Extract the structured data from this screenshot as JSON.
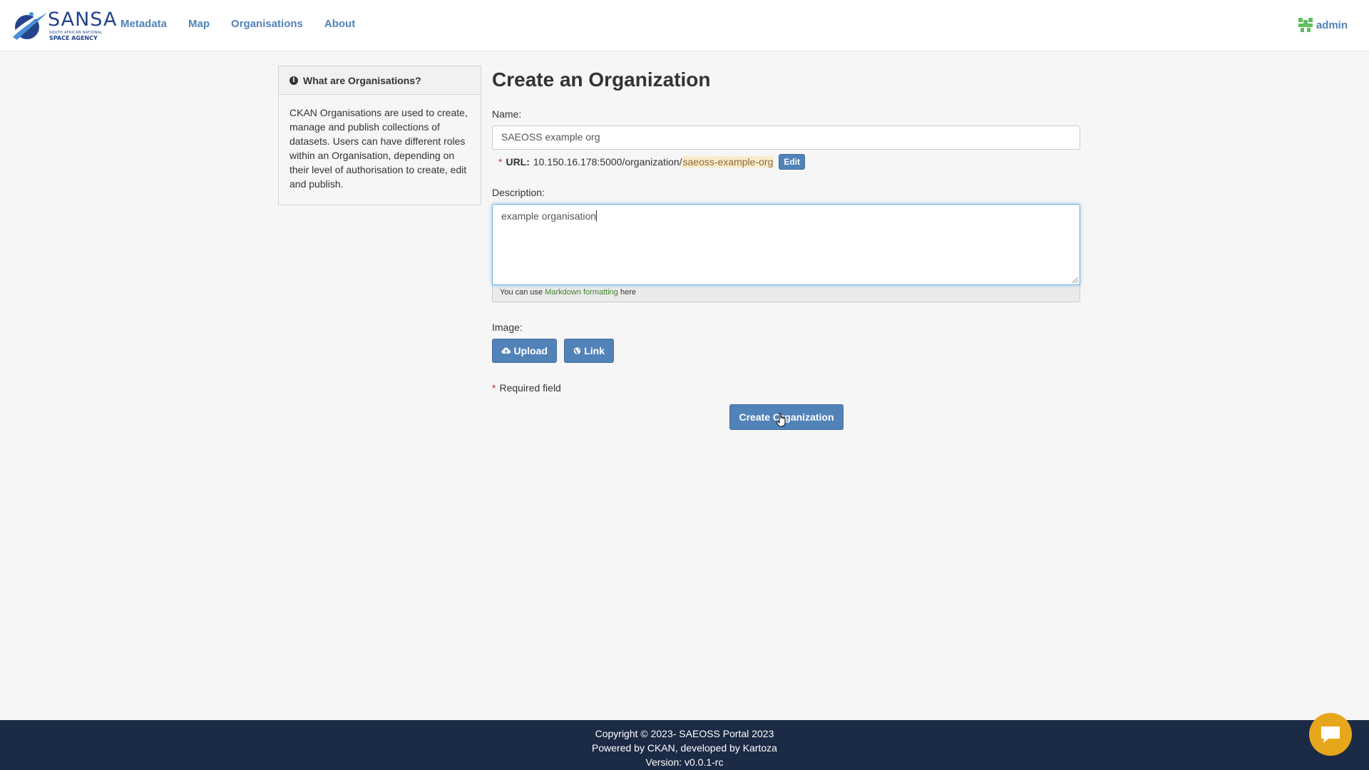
{
  "header": {
    "logo": {
      "main": "SANSA",
      "sub1": "SOUTH AFRICAN NATIONAL",
      "sub2": "SPACE AGENCY"
    },
    "nav": [
      {
        "label": "Metadata"
      },
      {
        "label": "Map"
      },
      {
        "label": "Organisations"
      },
      {
        "label": "About"
      }
    ],
    "user": {
      "name": "admin"
    }
  },
  "sidebar": {
    "title": "What are Organisations?",
    "body": "CKAN Organisations are used to create, manage and publish collections of datasets. Users can have different roles within an Organisation, depending on their level of authorisation to create, edit and publish."
  },
  "form": {
    "title": "Create an Organization",
    "name_label": "Name:",
    "name_value": "SAEOSS example org",
    "url_required_mark": "*",
    "url_label": "URL:",
    "url_prefix": "10.150.16.178:5000/organization/",
    "url_slug": "saeoss-example-org",
    "url_edit": "Edit",
    "description_label": "Description:",
    "description_value": "example organisation",
    "markdown_hint_pre": "You can use ",
    "markdown_link": "Markdown formatting",
    "markdown_hint_post": " here",
    "image_label": "Image:",
    "upload_label": "Upload",
    "link_label": "Link",
    "required_mark": "*",
    "required_text": "Required field",
    "submit_label": "Create Organization"
  },
  "footer": {
    "line1": "Copyright © 2023- SAEOSS Portal 2023",
    "line2": "Powered by CKAN, developed by Kartoza",
    "line3": "Version: v0.0.1-rc"
  },
  "colors": {
    "accent": "#5183b9",
    "footer_bg": "#1b2a45",
    "chat": "#e7a71c",
    "required": "#c6302e"
  }
}
